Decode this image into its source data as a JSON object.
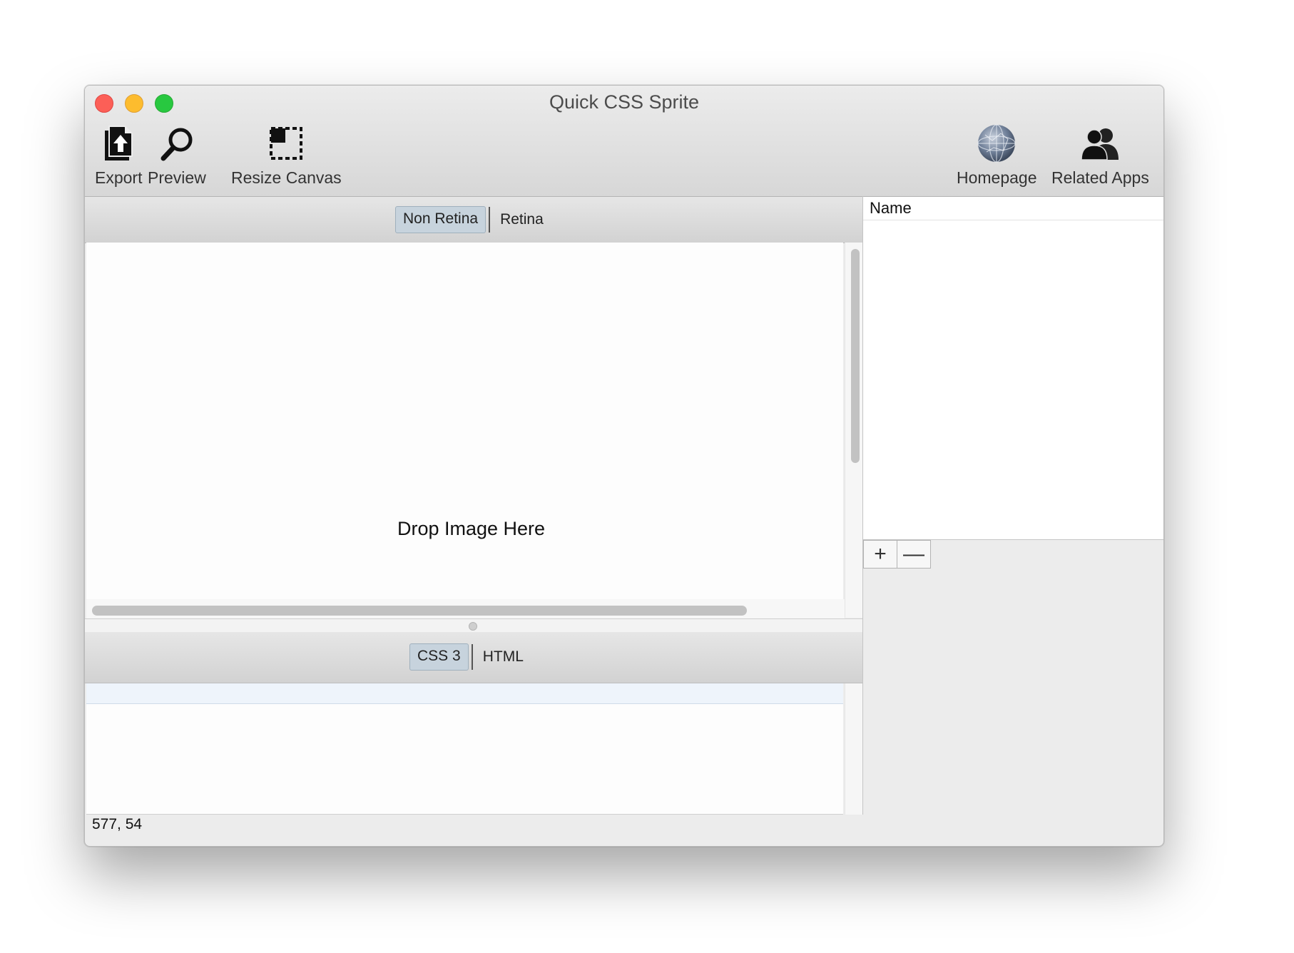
{
  "window": {
    "title": "Quick CSS Sprite"
  },
  "toolbar": {
    "export_label": "Export",
    "preview_label": "Preview",
    "resize_canvas_label": "Resize Canvas",
    "homepage_label": "Homepage",
    "related_apps_label": "Related Apps"
  },
  "canvas_tabs": {
    "options": [
      "Non Retina",
      "Retina"
    ],
    "selected": "Non Retina"
  },
  "canvas": {
    "drop_hint": "Drop Image Here"
  },
  "code_tabs": {
    "options": [
      "CSS 3",
      "HTML"
    ],
    "selected": "CSS 3"
  },
  "name_table": {
    "header": "Name",
    "add_button": "+",
    "remove_button": "—"
  },
  "status_bar": {
    "coordinates": "577, 54"
  },
  "colors": {
    "close": "#fc5f57",
    "minimize": "#fdbc2e",
    "maximize": "#28c840",
    "segment_selected": "#c7d3dd"
  }
}
